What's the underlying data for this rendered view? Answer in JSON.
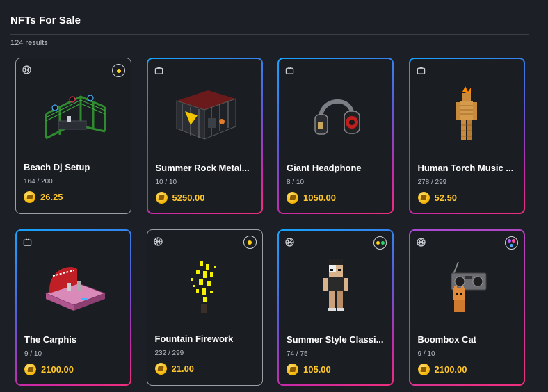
{
  "header": {
    "title": "NFTs For Sale",
    "result_count": "124 results"
  },
  "cards": [
    {
      "name": "Beach Dj Setup",
      "supply": "164 / 200",
      "price": "26.25",
      "type_icon": "sand-globe-icon",
      "badge": "yellow-dot",
      "art": "dj-stage"
    },
    {
      "name": "Summer Rock Metal...",
      "supply": "10 / 10",
      "price": "5250.00",
      "type_icon": "tv-icon",
      "badge": null,
      "art": "rock-stage"
    },
    {
      "name": "Giant Headphone",
      "supply": "8 / 10",
      "price": "1050.00",
      "type_icon": "tv-icon",
      "badge": null,
      "art": "headphone"
    },
    {
      "name": "Human Torch Music ...",
      "supply": "278 / 299",
      "price": "52.50",
      "type_icon": "tv-icon",
      "badge": null,
      "art": "torch-figure"
    },
    {
      "name": "The Carphis",
      "supply": "9 / 10",
      "price": "2100.00",
      "type_icon": "tv-icon",
      "badge": null,
      "art": "carphis-stage"
    },
    {
      "name": "Fountain Firework",
      "supply": "232 / 299",
      "price": "21.00",
      "type_icon": "sand-globe-icon",
      "badge": "yellow-dot",
      "art": "firework"
    },
    {
      "name": "Summer Style Classi...",
      "supply": "74 / 75",
      "price": "105.00",
      "type_icon": "sand-globe-icon",
      "badge": "two-yellow-green-dots",
      "art": "avatar"
    },
    {
      "name": "Boombox Cat",
      "supply": "9 / 10",
      "price": "2100.00",
      "type_icon": "sand-globe-icon",
      "badge": "purple-pink-dots",
      "art": "boombox-cat"
    }
  ],
  "colors": {
    "background": "#1c1f25",
    "price": "#ffc72c",
    "coin": "#f5b400",
    "gradient_border": [
      "#16a5ff",
      "#ee2e7c"
    ]
  }
}
